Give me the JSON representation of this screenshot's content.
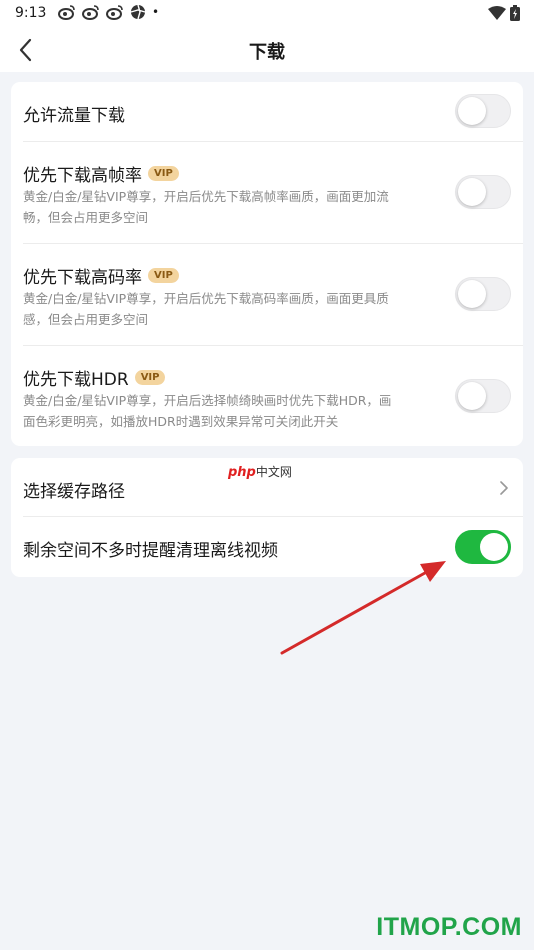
{
  "status_bar": {
    "time": "9:13",
    "notification_icons": [
      "weibo-icon",
      "weibo-icon",
      "weibo-icon",
      "aperture-icon"
    ],
    "dot": "•",
    "right_icons": [
      "wifi-icon",
      "battery-icon"
    ]
  },
  "header": {
    "title": "下载",
    "back_icon": "chevron-left-icon"
  },
  "settings": {
    "allow_data_download": {
      "label": "允许流量下载",
      "enabled": false
    },
    "high_frame_rate": {
      "label": "优先下载高帧率",
      "badge": "VIP",
      "desc_line1": "黄金/白金/星钻VIP尊享，开启后优先下载高帧率画质，画面更加流",
      "desc_line2": "畅，但会占用更多空间",
      "enabled": false
    },
    "high_bitrate": {
      "label": "优先下载高码率",
      "badge": "VIP",
      "desc_line1": "黄金/白金/星钻VIP尊享，开启后优先下载高码率画质，画面更具质",
      "desc_line2": "感，但会占用更多空间",
      "enabled": false
    },
    "hdr": {
      "label": "优先下载HDR",
      "badge": "VIP",
      "desc_line1": "黄金/白金/星钻VIP尊享，开启后选择帧绮映画时优先下载HDR，画",
      "desc_line2": "面色彩更明亮，如播放HDR时遇到效果异常可关闭此开关",
      "enabled": false
    },
    "cache_path": {
      "label": "选择缓存路径"
    },
    "low_space_reminder": {
      "label": "剩余空间不多时提醒清理离线视频",
      "enabled": true
    }
  },
  "watermarks": {
    "php_red": "php",
    "php_cn": "中文网",
    "itmop": "ITMOP.COM"
  },
  "colors": {
    "toggle_on": "#1fb840",
    "vip_badge_bg": "#f3d49e",
    "vip_badge_text": "#8a5a14",
    "annotation_arrow": "#d42a2a",
    "itmop": "#21a44a"
  }
}
